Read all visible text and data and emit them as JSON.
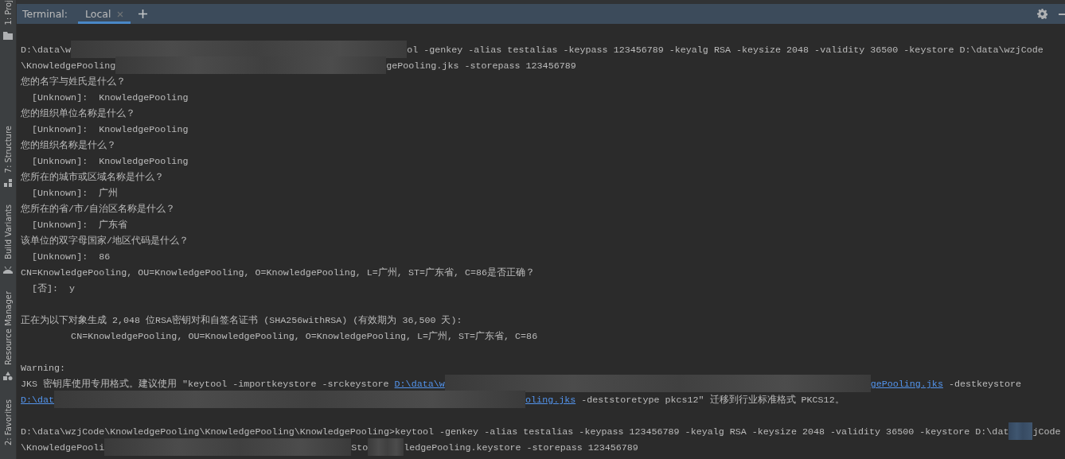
{
  "sidebar": {
    "items": [
      {
        "label": "1: Proj"
      },
      {
        "label": "7: Structure"
      },
      {
        "label": "Build Variants"
      },
      {
        "label": "Resource Manager"
      },
      {
        "label": "2: Favorites"
      }
    ]
  },
  "toolbar": {
    "title": "Terminal:",
    "tabs": [
      {
        "label": "Local",
        "selected": true
      }
    ]
  },
  "terminal": {
    "lines": [
      {
        "kind": "blank"
      },
      {
        "kind": "output",
        "segments": [
          {
            "kind": "text",
            "text": "D:\\data\\w"
          },
          {
            "kind": "blur"
          },
          {
            "kind": "text",
            "text": "ol -genkey -alias testalias -keypass 123456789 -keyalg RSA -keysize 2048 -validity 36500 -keystore D:\\data\\wzjCode"
          }
        ]
      },
      {
        "kind": "output",
        "segments": [
          {
            "kind": "text",
            "text": "\\KnowledgePooling"
          },
          {
            "kind": "blur"
          },
          {
            "kind": "text",
            "text": "gePooling.jks -storepass 123456789"
          }
        ]
      },
      {
        "kind": "output",
        "segments": [
          {
            "kind": "text",
            "text": "您的名字与姓氏是什么？"
          }
        ]
      },
      {
        "kind": "output",
        "segments": [
          {
            "kind": "text",
            "text": "  [Unknown]:  KnowledgePooling"
          }
        ]
      },
      {
        "kind": "output",
        "segments": [
          {
            "kind": "text",
            "text": "您的组织单位名称是什么？"
          }
        ]
      },
      {
        "kind": "output",
        "segments": [
          {
            "kind": "text",
            "text": "  [Unknown]:  KnowledgePooling"
          }
        ]
      },
      {
        "kind": "output",
        "segments": [
          {
            "kind": "text",
            "text": "您的组织名称是什么？"
          }
        ]
      },
      {
        "kind": "output",
        "segments": [
          {
            "kind": "text",
            "text": "  [Unknown]:  KnowledgePooling"
          }
        ]
      },
      {
        "kind": "output",
        "segments": [
          {
            "kind": "text",
            "text": "您所在的城市或区域名称是什么？"
          }
        ]
      },
      {
        "kind": "output",
        "segments": [
          {
            "kind": "text",
            "text": "  [Unknown]:  广州"
          }
        ]
      },
      {
        "kind": "output",
        "segments": [
          {
            "kind": "text",
            "text": "您所在的省/市/自治区名称是什么？"
          }
        ]
      },
      {
        "kind": "output",
        "segments": [
          {
            "kind": "text",
            "text": "  [Unknown]:  广东省"
          }
        ]
      },
      {
        "kind": "output",
        "segments": [
          {
            "kind": "text",
            "text": "该单位的双字母国家/地区代码是什么？"
          }
        ]
      },
      {
        "kind": "output",
        "segments": [
          {
            "kind": "text",
            "text": "  [Unknown]:  86"
          }
        ]
      },
      {
        "kind": "output",
        "segments": [
          {
            "kind": "text",
            "text": "CN=KnowledgePooling, OU=KnowledgePooling, O=KnowledgePooling, L=广州, ST=广东省, C=86是否正确？"
          }
        ]
      },
      {
        "kind": "output",
        "segments": [
          {
            "kind": "text",
            "text": "  [否]:  y"
          }
        ]
      },
      {
        "kind": "blank"
      },
      {
        "kind": "output",
        "segments": [
          {
            "kind": "text",
            "text": "正在为以下对象生成 2,048 位RSA密钥对和自签名证书 (SHA256withRSA) (有效期为 36,500 天):"
          }
        ]
      },
      {
        "kind": "output",
        "segments": [
          {
            "kind": "text",
            "text": "         CN=KnowledgePooling, OU=KnowledgePooling, O=KnowledgePooling, L=广州, ST=广东省, C=86"
          }
        ]
      },
      {
        "kind": "blank"
      },
      {
        "kind": "output",
        "segments": [
          {
            "kind": "text",
            "text": "Warning:"
          }
        ]
      },
      {
        "kind": "output",
        "segments": [
          {
            "kind": "text",
            "text": "JKS 密钥库使用专用格式。建议使用 \"keytool -importkeystore -srckeystore "
          },
          {
            "kind": "link",
            "text": "D:\\data\\w"
          },
          {
            "kind": "blur"
          },
          {
            "kind": "link",
            "text": "gePooling.jks"
          },
          {
            "kind": "text",
            "text": " -destkeystore"
          }
        ]
      },
      {
        "kind": "output",
        "segments": [
          {
            "kind": "link",
            "text": "D:\\dat"
          },
          {
            "kind": "blur"
          },
          {
            "kind": "link",
            "text": "oling.jks"
          },
          {
            "kind": "text",
            "text": " -deststoretype pkcs12\" 迁移到行业标准格式 PKCS12。"
          }
        ]
      },
      {
        "kind": "blank"
      },
      {
        "kind": "output",
        "segments": [
          {
            "kind": "text",
            "text": "D:\\data\\wzjCode\\KnowledgePooling\\KnowledgePooling\\KnowledgePooling>keytool -genkey -alias testalias -keypass 123456789 -keyalg RSA -keysize 2048 -validity 36500 -keystore D:\\dat"
          },
          {
            "kind": "blur"
          },
          {
            "kind": "text",
            "text": "jCode"
          }
        ]
      },
      {
        "kind": "output",
        "segments": [
          {
            "kind": "text",
            "text": "\\KnowledgePooli"
          },
          {
            "kind": "blur"
          },
          {
            "kind": "text",
            "text": "Sto"
          },
          {
            "kind": "blur"
          },
          {
            "kind": "text",
            "text": "ledgePooling.keystore -storepass 123456789"
          }
        ]
      }
    ]
  }
}
